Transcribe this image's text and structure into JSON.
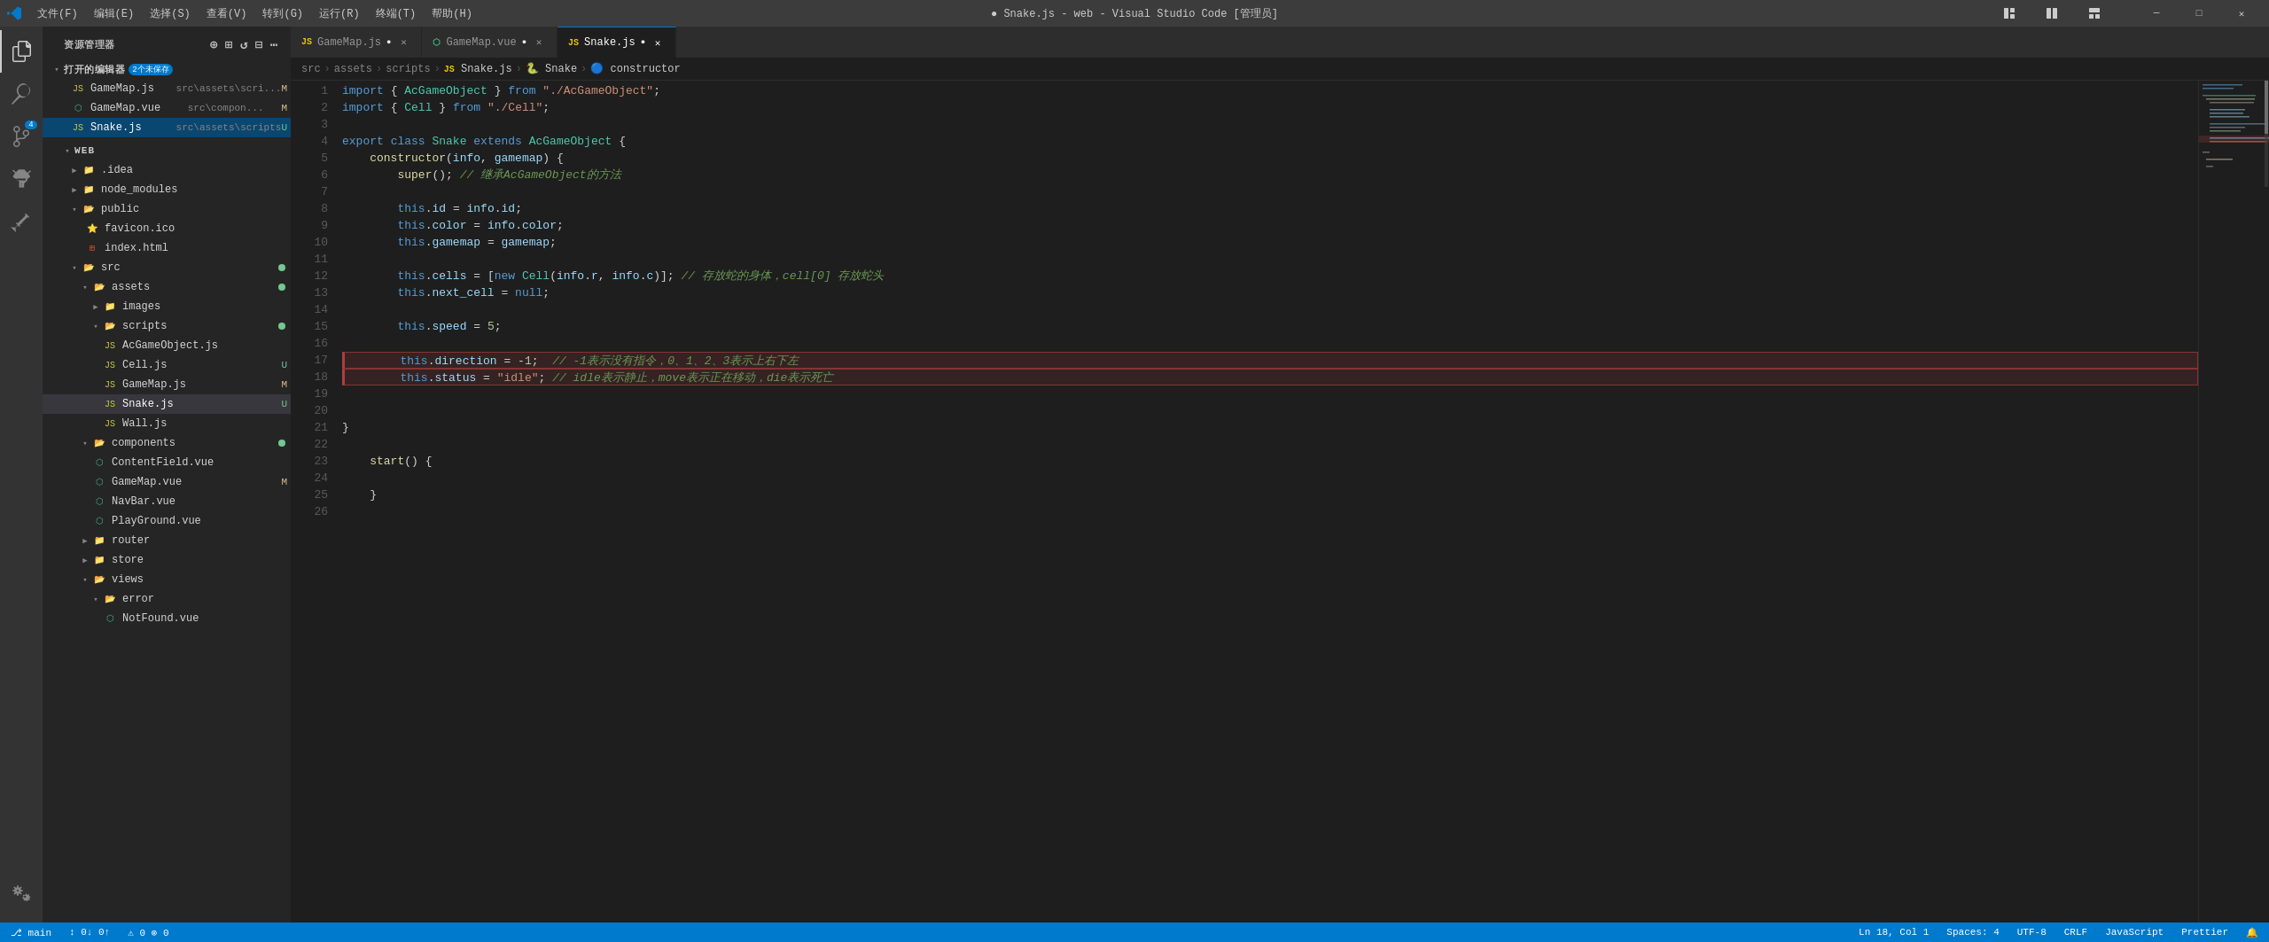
{
  "titleBar": {
    "title": "● Snake.js - web - Visual Studio Code [管理员]",
    "menus": [
      "文件(F)",
      "编辑(E)",
      "选择(S)",
      "查看(V)",
      "转到(G)",
      "运行(R)",
      "终端(T)",
      "帮助(H)"
    ]
  },
  "sidebar": {
    "explorerTitle": "资源管理器",
    "openEditorsTitle": "打开的编辑器",
    "unsavedCount": "2个未保存",
    "openEditors": [
      {
        "name": "GameMap.js",
        "path": "src\\assets\\scri...",
        "badge": "M",
        "type": "js"
      },
      {
        "name": "GameMap.vue",
        "path": "src\\compon...",
        "badge": "M",
        "type": "vue"
      },
      {
        "name": "Snake.js",
        "path": "src\\assets\\scripts",
        "badge": "U",
        "type": "js",
        "active": true
      }
    ],
    "webFolder": "WEB",
    "tree": [
      {
        "label": ".idea",
        "type": "folder",
        "indent": 1,
        "collapsed": true
      },
      {
        "label": "node_modules",
        "type": "folder",
        "indent": 1,
        "collapsed": true
      },
      {
        "label": "public",
        "type": "folder",
        "indent": 1,
        "expanded": true
      },
      {
        "label": "favicon.ico",
        "type": "file",
        "indent": 2,
        "icon": "star"
      },
      {
        "label": "index.html",
        "type": "file",
        "indent": 2
      },
      {
        "label": "src",
        "type": "folder",
        "indent": 1,
        "expanded": true,
        "dot": "green"
      },
      {
        "label": "assets",
        "type": "folder",
        "indent": 2,
        "expanded": true,
        "dot": "green"
      },
      {
        "label": "images",
        "type": "folder",
        "indent": 3,
        "collapsed": true
      },
      {
        "label": "scripts",
        "type": "folder",
        "indent": 3,
        "expanded": true,
        "dot": "green"
      },
      {
        "label": "AcGameObject.js",
        "type": "js",
        "indent": 4
      },
      {
        "label": "Cell.js",
        "type": "js",
        "indent": 4,
        "badge": "U"
      },
      {
        "label": "GameMap.js",
        "type": "js",
        "indent": 4,
        "badge": "M"
      },
      {
        "label": "Snake.js",
        "type": "js",
        "indent": 4,
        "badge": "U",
        "active": true
      },
      {
        "label": "Wall.js",
        "type": "js",
        "indent": 4
      },
      {
        "label": "components",
        "type": "folder",
        "indent": 2,
        "expanded": true,
        "dot": "green"
      },
      {
        "label": "ContentField.vue",
        "type": "vue",
        "indent": 3
      },
      {
        "label": "GameMap.vue",
        "type": "vue",
        "indent": 3,
        "badge": "M"
      },
      {
        "label": "NavBar.vue",
        "type": "vue",
        "indent": 3
      },
      {
        "label": "PlayGround.vue",
        "type": "vue",
        "indent": 3
      },
      {
        "label": "router",
        "type": "folder",
        "indent": 2,
        "collapsed": true
      },
      {
        "label": "store",
        "type": "folder",
        "indent": 2,
        "collapsed": true
      },
      {
        "label": "views",
        "type": "folder",
        "indent": 2,
        "expanded": true
      },
      {
        "label": "error",
        "type": "folder",
        "indent": 3,
        "expanded": true
      },
      {
        "label": "NotFound.vue",
        "type": "vue",
        "indent": 4
      }
    ]
  },
  "tabs": [
    {
      "name": "GameMap.js",
      "type": "js",
      "modified": true,
      "active": false
    },
    {
      "name": "GameMap.vue",
      "type": "vue",
      "modified": true,
      "active": false
    },
    {
      "name": "Snake.js",
      "type": "js",
      "modified": false,
      "unsaved": true,
      "active": true
    }
  ],
  "breadcrumb": [
    "src",
    ">",
    "assets",
    ">",
    "scripts",
    ">",
    "JS Snake.js",
    ">",
    "🐍 Snake",
    ">",
    "🔵 constructor"
  ],
  "code": {
    "lines": [
      {
        "num": 1,
        "content": "import { AcGameObject } from \"./AcGameObject\";"
      },
      {
        "num": 2,
        "content": "import { Cell } from \"./Cell\";"
      },
      {
        "num": 3,
        "content": ""
      },
      {
        "num": 4,
        "content": "export class Snake extends AcGameObject {"
      },
      {
        "num": 5,
        "content": "    constructor(info, gamemap) {"
      },
      {
        "num": 6,
        "content": "        super(); // 继承AcGameObject的方法"
      },
      {
        "num": 7,
        "content": ""
      },
      {
        "num": 8,
        "content": "        this.id = info.id;"
      },
      {
        "num": 9,
        "content": "        this.color = info.color;"
      },
      {
        "num": 10,
        "content": "        this.gamemap = gamemap;"
      },
      {
        "num": 11,
        "content": ""
      },
      {
        "num": 12,
        "content": "        this.cells = [new Cell(info.r, info.c)]; // 存放蛇的身体，cell[0] 存放蛇头"
      },
      {
        "num": 13,
        "content": "        this.next_cell = null;"
      },
      {
        "num": 14,
        "content": ""
      },
      {
        "num": 15,
        "content": "        this.speed = 5;"
      },
      {
        "num": 16,
        "content": ""
      },
      {
        "num": 17,
        "content": "        this.direction = -1;  // -1表示没有指令，0、1、2、3表示上右下左",
        "highlighted": true
      },
      {
        "num": 18,
        "content": "        this.status = \"idle\"; // idle表示静止，move表示正在移动，die表示死亡",
        "highlighted": true
      },
      {
        "num": 19,
        "content": ""
      },
      {
        "num": 20,
        "content": ""
      },
      {
        "num": 21,
        "content": "}"
      },
      {
        "num": 22,
        "content": ""
      },
      {
        "num": 23,
        "content": "    start() {"
      },
      {
        "num": 24,
        "content": ""
      },
      {
        "num": 25,
        "content": "    }"
      },
      {
        "num": 26,
        "content": ""
      }
    ]
  },
  "statusBar": {
    "left": [
      {
        "label": "⎇ main"
      },
      {
        "label": "⚠ 0"
      },
      {
        "label": "⊗ 0"
      }
    ],
    "right": [
      {
        "label": "Ln 18, Col 1"
      },
      {
        "label": "Spaces: 4"
      },
      {
        "label": "UTF-8"
      },
      {
        "label": "CRLF"
      },
      {
        "label": "JavaScript"
      },
      {
        "label": "Prettier"
      },
      {
        "label": "🔔"
      }
    ]
  }
}
